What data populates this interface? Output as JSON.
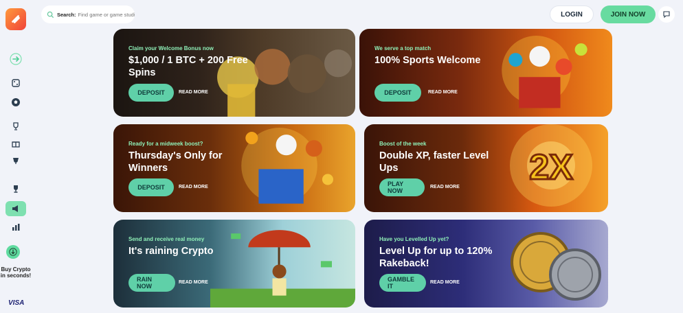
{
  "search": {
    "label": "Search:",
    "placeholder": "Find game or game studio"
  },
  "header": {
    "login_label": "LOGIN",
    "join_label": "JOIN NOW"
  },
  "sidebar": {
    "icons": [
      "collapse-icon",
      "casino-icon",
      "sports-ball-icon",
      "trophy-icon",
      "gift-icon",
      "cup-icon",
      "leaderboard-trophy-icon",
      "promotions-icon",
      "stats-icon"
    ],
    "buy_crypto_text": "Buy Crypto in seconds!",
    "visa_label": "VISA"
  },
  "promos": [
    {
      "kicker": "Claim your Welcome Bonus now",
      "title": "$1,000 / 1 BTC + 200 Free Spins",
      "cta": "DEPOSIT",
      "more": "READ MORE"
    },
    {
      "kicker": "We serve a top match",
      "title": "100% Sports Welcome",
      "cta": "DEPOSIT",
      "more": "READ MORE"
    },
    {
      "kicker": "Ready for a midweek boost?",
      "title": "Thursday's Only for Winners",
      "cta": "DEPOSIT",
      "more": "READ MORE"
    },
    {
      "kicker": "Boost of the week",
      "title": "Double XP, faster Level Ups",
      "cta": "PLAY NOW",
      "more": "READ MORE"
    },
    {
      "kicker": "Send and receive real money",
      "title": "It's raining Crypto",
      "cta": "RAIN NOW",
      "more": "READ MORE"
    },
    {
      "kicker": "Have you Levelled Up yet?",
      "title": "Level Up for up to 120% Rakeback!",
      "cta": "GAMBLE IT",
      "more": "READ MORE"
    }
  ],
  "art": {
    "boost_badge": "2X"
  },
  "colors": {
    "accent": "#68dba0",
    "cta": "#5fd0a8",
    "kicker": "#8ff0b8",
    "logo_start": "#ff9a3c",
    "logo_end": "#f0433a"
  }
}
